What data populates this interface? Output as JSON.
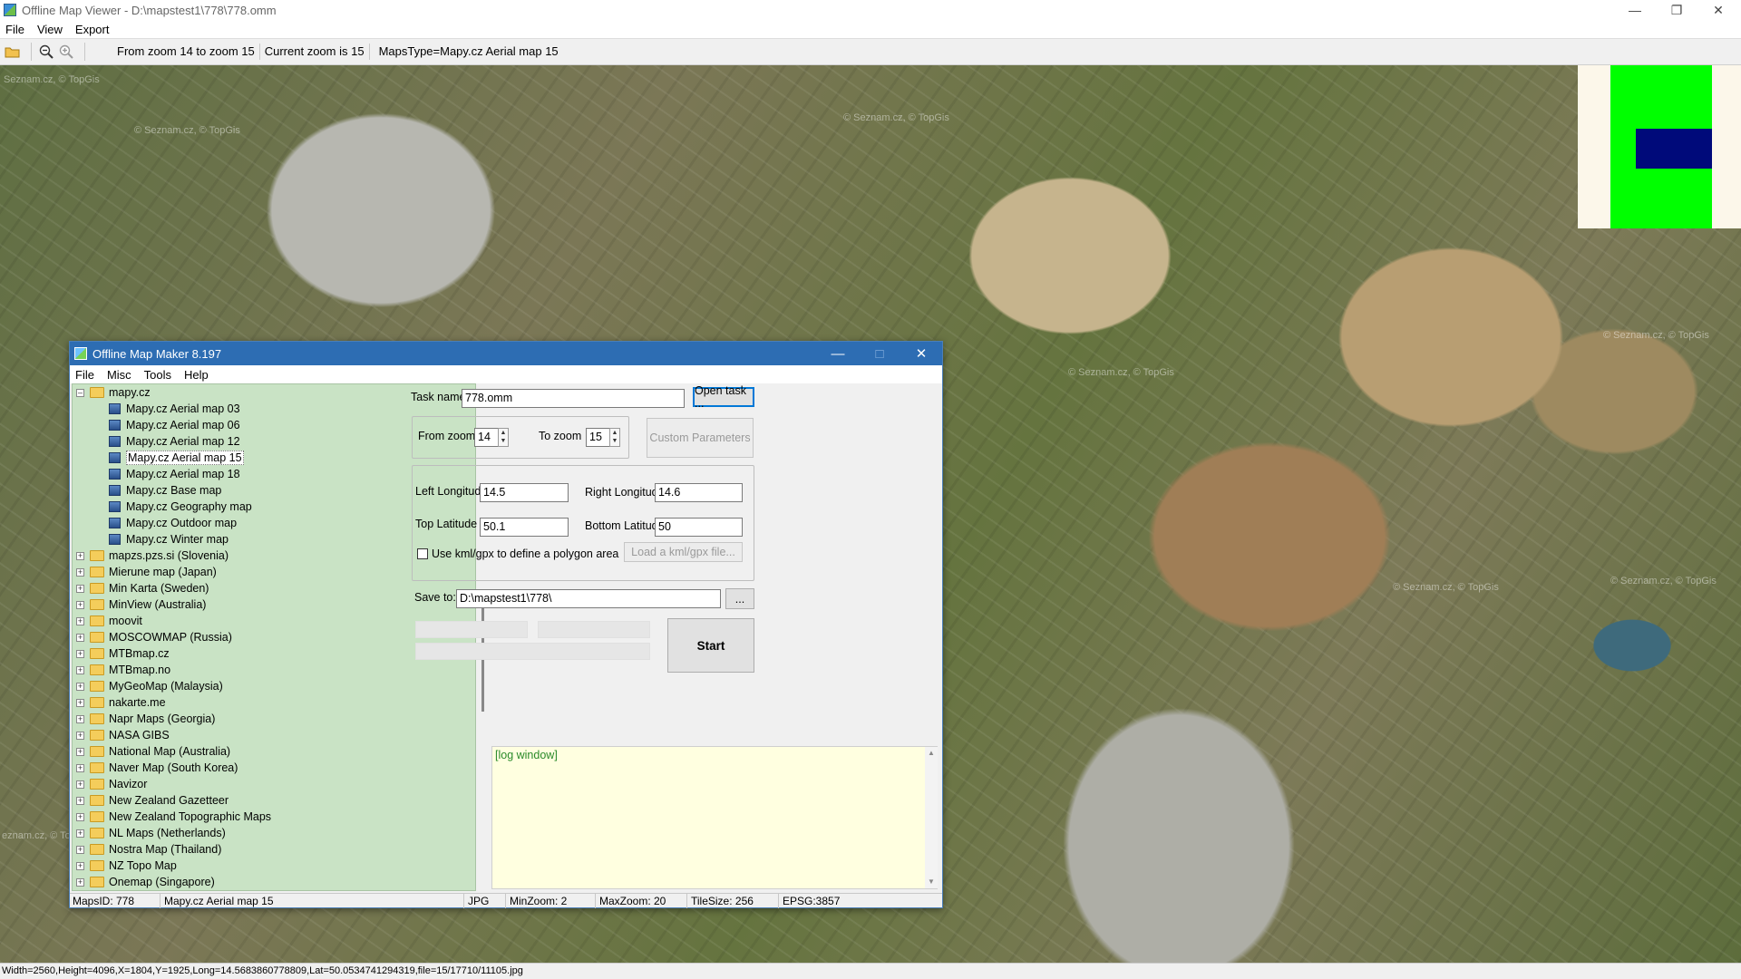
{
  "app": {
    "title": "Offline Map Viewer - D:\\mapstest1\\778\\778.omm",
    "menu": [
      "File",
      "View",
      "Export"
    ],
    "toolbar": {
      "zoom_range": "From zoom 14 to zoom 15",
      "current_zoom": "Current zoom is 15",
      "maps_type": "MapsType=Mapy.cz Aerial map 15"
    },
    "status": "Width=2560,Height=4096,X=1804,Y=1925,Long=14.5683860778809,Lat=50.0534741294319,file=15/17710/11105.jpg"
  },
  "map": {
    "watermarks": [
      "Seznam.cz, © TopGis",
      "© Seznam.cz, © TopGis",
      "© Seznam.cz, © TopGis",
      "© Seznam.cz, © TopGis",
      "© Seznam.cz, © TopGis",
      "© Seznam.cz, © TopGis",
      "eznam.cz, © TopGis",
      "© Seznam.cz, © TopGis"
    ]
  },
  "colors": {
    "minimap_bg": "#fcf7ea",
    "minimap_green": "#00ff00",
    "minimap_blue": "#000a7a",
    "dialog_title": "#2d6db3",
    "tree_bg": "#c9e3c5",
    "log_bg": "#ffffe0"
  },
  "dialog": {
    "title": "Offline Map Maker 8.197",
    "menu": [
      "File",
      "Misc",
      "Tools",
      "Help"
    ],
    "tree": {
      "root": "mapy.cz",
      "children": [
        "Mapy.cz Aerial map 03",
        "Mapy.cz Aerial map 06",
        "Mapy.cz Aerial map 12",
        "Mapy.cz Aerial map 15",
        "Mapy.cz Aerial map 18",
        "Mapy.cz Base map",
        "Mapy.cz Geography map",
        "Mapy.cz Outdoor map",
        "Mapy.cz Winter map"
      ],
      "selected_index": 3,
      "folders": [
        "mapzs.pzs.si (Slovenia)",
        "Mierune map (Japan)",
        "Min Karta (Sweden)",
        "MinView (Australia)",
        "moovit",
        "MOSCOWMAP (Russia)",
        "MTBmap.cz",
        "MTBmap.no",
        "MyGeoMap (Malaysia)",
        "nakarte.me",
        "Napr Maps (Georgia)",
        "NASA GIBS",
        "National Map (Australia)",
        "Naver Map (South Korea)",
        "Navizor",
        "New Zealand Gazetteer",
        "New Zealand Topographic Maps",
        "NL Maps (Netherlands)",
        "Nostra Map (Thailand)",
        "NZ Topo Map",
        "Onemap (Singapore)"
      ]
    },
    "form": {
      "task_name_label": "Task name",
      "task_name": "778.omm",
      "open_task": "Open task ...",
      "from_zoom_label": "From zoom",
      "from_zoom": "14",
      "to_zoom_label": "To zoom",
      "to_zoom": "15",
      "custom_params": "Custom Parameters",
      "left_lon_label": "Left Longitude",
      "left_lon": "14.5",
      "right_lon_label": "Right Longitude",
      "right_lon": "14.6",
      "top_lat_label": "Top Latitude",
      "top_lat": "50.1",
      "bottom_lat_label": "Bottom Latitude",
      "bottom_lat": "50",
      "kml_label": "Use kml/gpx to define a polygon area",
      "kml_checked": false,
      "load_kml": "Load a kml/gpx file...",
      "save_to_label": "Save to:",
      "save_to": "D:\\mapstest1\\778\\",
      "browse": "...",
      "start": "Start"
    },
    "log": "[log window]",
    "status": {
      "maps_id": "MapsID: 778",
      "map_name": "Mapy.cz Aerial map 15",
      "format": "JPG",
      "min_zoom": "MinZoom: 2",
      "max_zoom": "MaxZoom: 20",
      "tile_size": "TileSize: 256",
      "epsg": "EPSG:3857"
    }
  }
}
